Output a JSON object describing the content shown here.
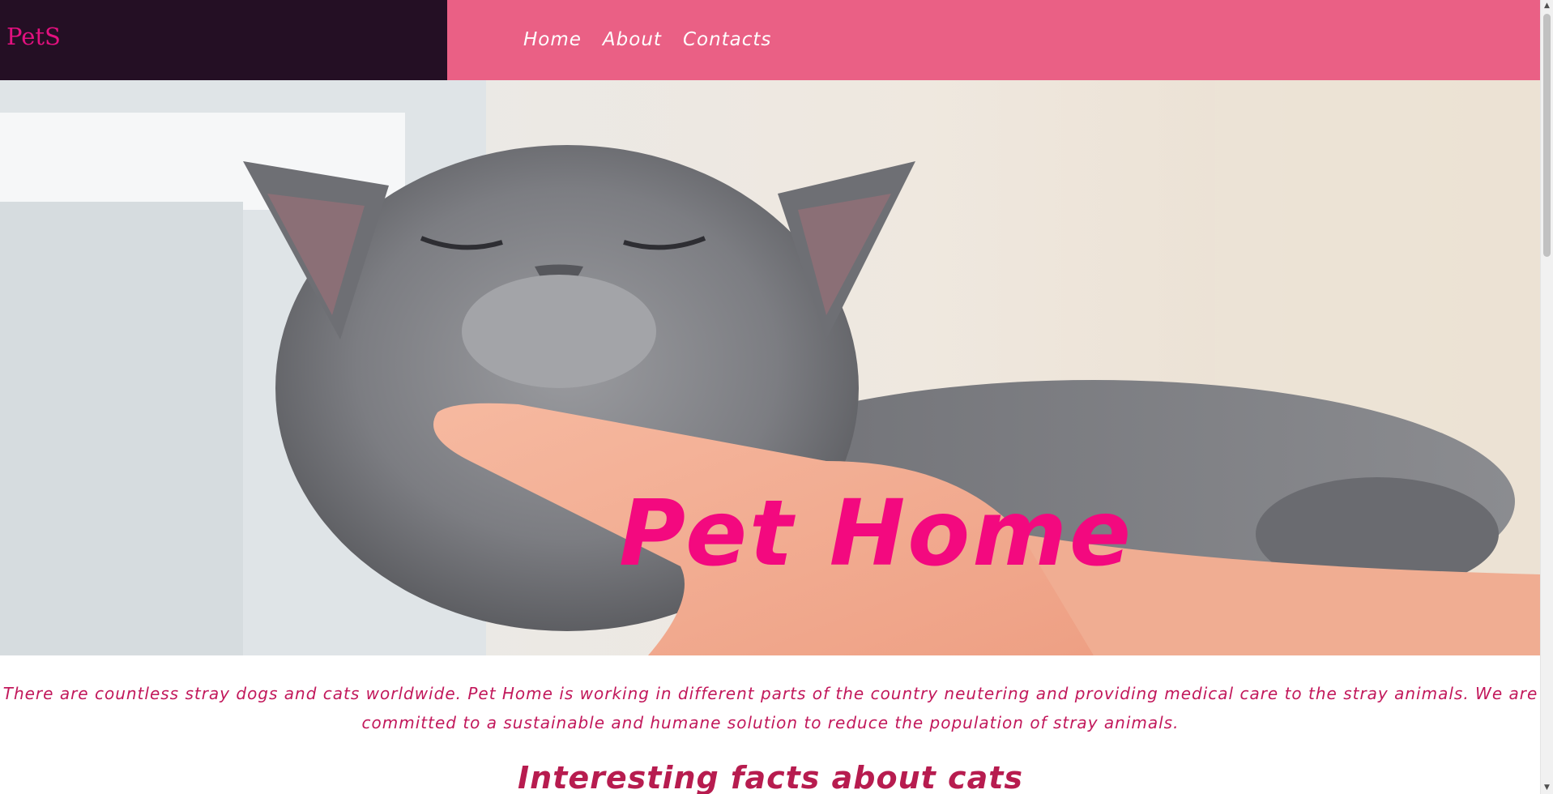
{
  "header": {
    "brand": "PetS",
    "nav": [
      {
        "label": "Home"
      },
      {
        "label": "About"
      },
      {
        "label": "Contacts"
      }
    ]
  },
  "hero": {
    "image": "cat-being-scratched-under-chin",
    "title": "Pet Home"
  },
  "intro": {
    "text": "There are countless stray dogs and cats worldwide. Pet Home is working in different parts of the country neutering and providing medical care to the stray animals. We are committed to a sustainable and humane solution to reduce the population of stray animals."
  },
  "facts": {
    "heading": "Interesting facts about cats"
  },
  "colors": {
    "brand_bg": "#240f24",
    "nav_bg": "#ea6085",
    "accent": "#f3097f",
    "text": "#c2185b"
  },
  "icons": {
    "scroll_up": "scroll-up-arrow-icon",
    "scroll_down": "scroll-down-arrow-icon"
  }
}
